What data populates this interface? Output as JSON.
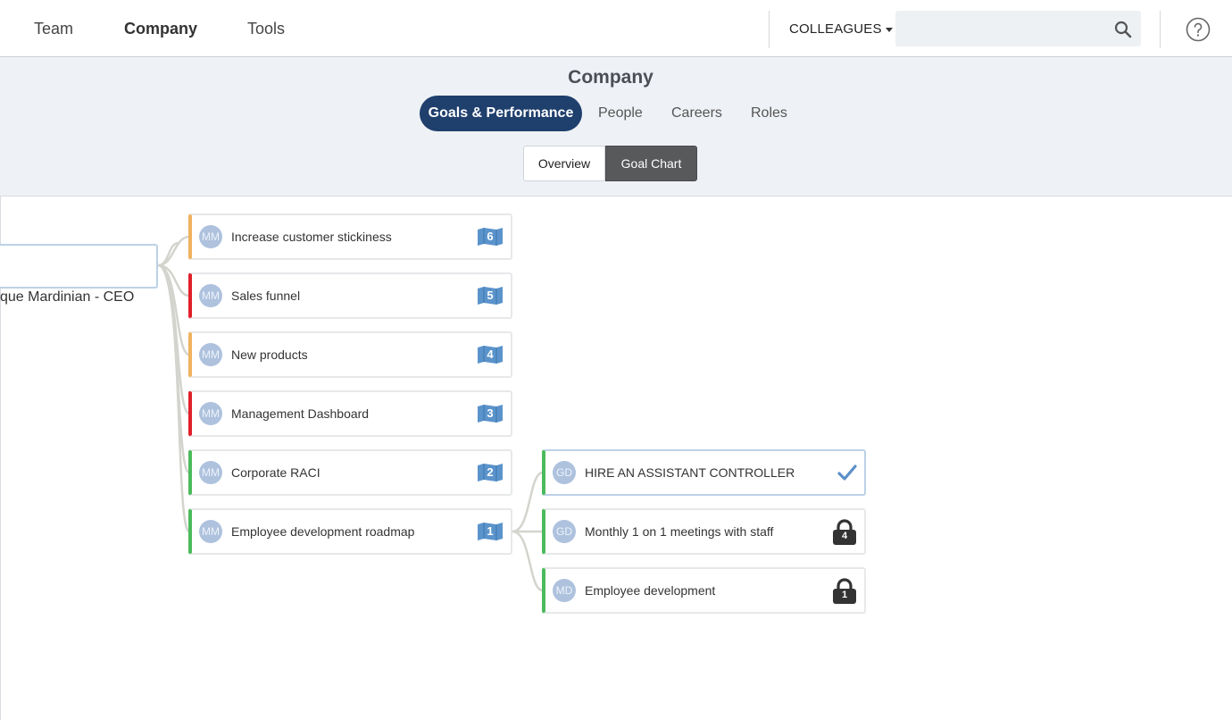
{
  "topnav": {
    "tabs": [
      "Team",
      "Company",
      "Tools"
    ],
    "colleagues_label": "COLLEAGUES",
    "search_placeholder": ""
  },
  "header": {
    "title": "Company",
    "pills": [
      "Goals & Performance",
      "People",
      "Careers",
      "Roles"
    ],
    "segments": [
      "Overview",
      "Goal Chart"
    ]
  },
  "chart": {
    "root_label": "que Mardinian - CEO",
    "goals": [
      {
        "initials": "MM",
        "label": "Increase customer stickiness",
        "count": "6",
        "status_color": "#f0b25d"
      },
      {
        "initials": "MM",
        "label": "Sales funnel",
        "count": "5",
        "status_color": "#e0202a"
      },
      {
        "initials": "MM",
        "label": "New products",
        "count": "4",
        "status_color": "#f0b25d"
      },
      {
        "initials": "MM",
        "label": "Management Dashboard",
        "count": "3",
        "status_color": "#e0202a"
      },
      {
        "initials": "MM",
        "label": "Corporate RACI",
        "count": "2",
        "status_color": "#4cba5c"
      },
      {
        "initials": "MM",
        "label": "Employee development roadmap",
        "count": "1",
        "status_color": "#4cba5c"
      }
    ],
    "subgoals": [
      {
        "initials": "GD",
        "label": "HIRE AN ASSISTANT CONTROLLER",
        "indicator": "check-icon",
        "status_color": "#4cba5c"
      },
      {
        "initials": "GD",
        "label": "Monthly 1 on 1 meetings with staff",
        "indicator": "lock-icon",
        "lock_count": "4",
        "status_color": "#4cba5c"
      },
      {
        "initials": "MD",
        "label": "Employee development",
        "indicator": "lock-icon",
        "lock_count": "1",
        "status_color": "#4cba5c"
      }
    ]
  }
}
